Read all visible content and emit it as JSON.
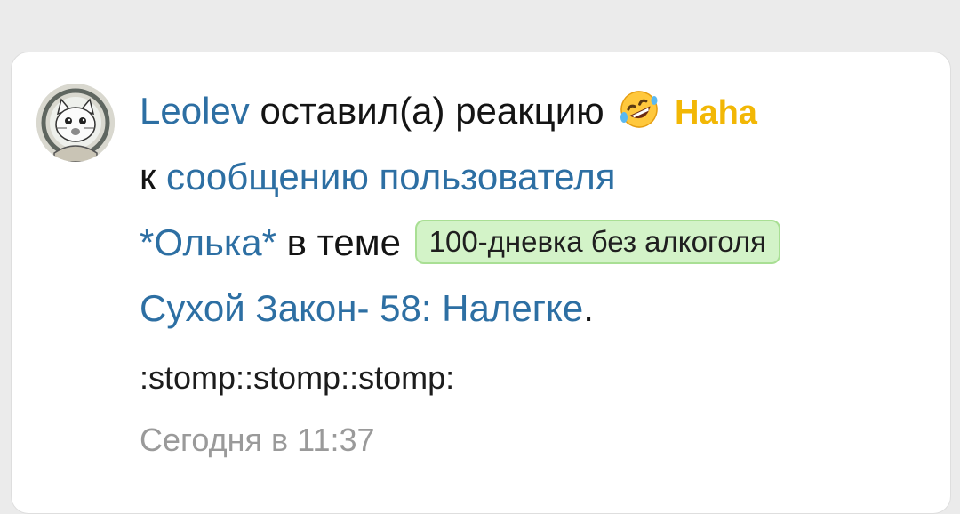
{
  "notification": {
    "user_name": "Leolev",
    "action_text": "оставил(а) реакцию",
    "reaction_icon": "rolling-on-floor-laughing-emoji",
    "reaction_label": "Haha",
    "preposition": "к",
    "message_link": "сообщению пользователя",
    "target_user": "*Олька*",
    "in_thread": "в теме",
    "thread_prefix": "100-дневка без алкоголя",
    "thread_title": "Сухой Закон- 58: Налегке",
    "end_punct": ".",
    "comment": ":stomp::stomp::stomp:",
    "timestamp": "Сегодня в 11:37"
  },
  "colors": {
    "link": "#2d6fa3",
    "reaction": "#f2b705",
    "prefix_bg": "#d3f3c8",
    "timestamp": "#9a9a9a",
    "page_bg": "#ebebeb"
  }
}
